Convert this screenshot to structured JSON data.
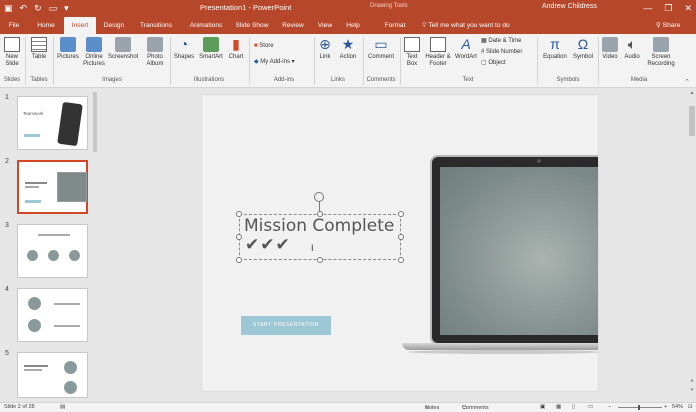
{
  "titlebar": {
    "qat_icons": [
      "save-icon",
      "undo-icon",
      "redo-icon",
      "present-icon",
      "customize-icon"
    ],
    "title": "Presentation1 - PowerPoint",
    "context_title": "Drawing Tools",
    "user": "Andrew Childress",
    "win_controls": [
      "—",
      "❐",
      "✕"
    ]
  },
  "tabs": {
    "file": "File",
    "home": "Home",
    "insert": "Insert",
    "design": "Design",
    "transitions": "Transitions",
    "animations": "Animations",
    "slideshow": "Slide Show",
    "review": "Review",
    "view": "View",
    "help": "Help",
    "format": "Format",
    "tellme": "Tell me what you want to do",
    "share": "Share"
  },
  "ribbon": {
    "new_slide": "New Slide",
    "table": "Table",
    "pictures": "Pictures",
    "online_pictures": "Online Pictures",
    "screenshot": "Screenshot",
    "photo_album": "Photo Album",
    "shapes": "Shapes",
    "smartart": "SmartArt",
    "chart": "Chart",
    "store": "Store",
    "my_addins": "My Add-ins",
    "link": "Link",
    "action": "Action",
    "comment": "Comment",
    "text_box": "Text Box",
    "header_footer": "Header & Footer",
    "wordart": "WordArt",
    "date_time": "Date & Time",
    "slide_number": "Slide Number",
    "object": "Object",
    "equation": "Equation",
    "symbol": "Symbol",
    "video": "Video",
    "audio": "Audio",
    "screen_recording": "Screen Recording",
    "groups": {
      "slides": "Slides",
      "tables": "Tables",
      "images": "Images",
      "illustrations": "Illustrations",
      "addins": "Add-ins",
      "links": "Links",
      "comments": "Comments",
      "text": "Text",
      "symbols": "Symbols",
      "media": "Media"
    }
  },
  "thumbnails": {
    "numbers": [
      "1",
      "2",
      "3",
      "4",
      "5"
    ],
    "slide1_title": "Teamwork"
  },
  "slide": {
    "title": "Mission Complete",
    "checks": "✔✔✔",
    "button": "START PRESENTATION"
  },
  "status": {
    "slide_info": "Slide 2 of 28",
    "notes": "Notes",
    "comments": "Comments",
    "zoom": "54%"
  },
  "colors": {
    "accent": "#b7472a",
    "ribbon_bg": "#f3f3f3",
    "button_teal": "#9cc7d4"
  }
}
